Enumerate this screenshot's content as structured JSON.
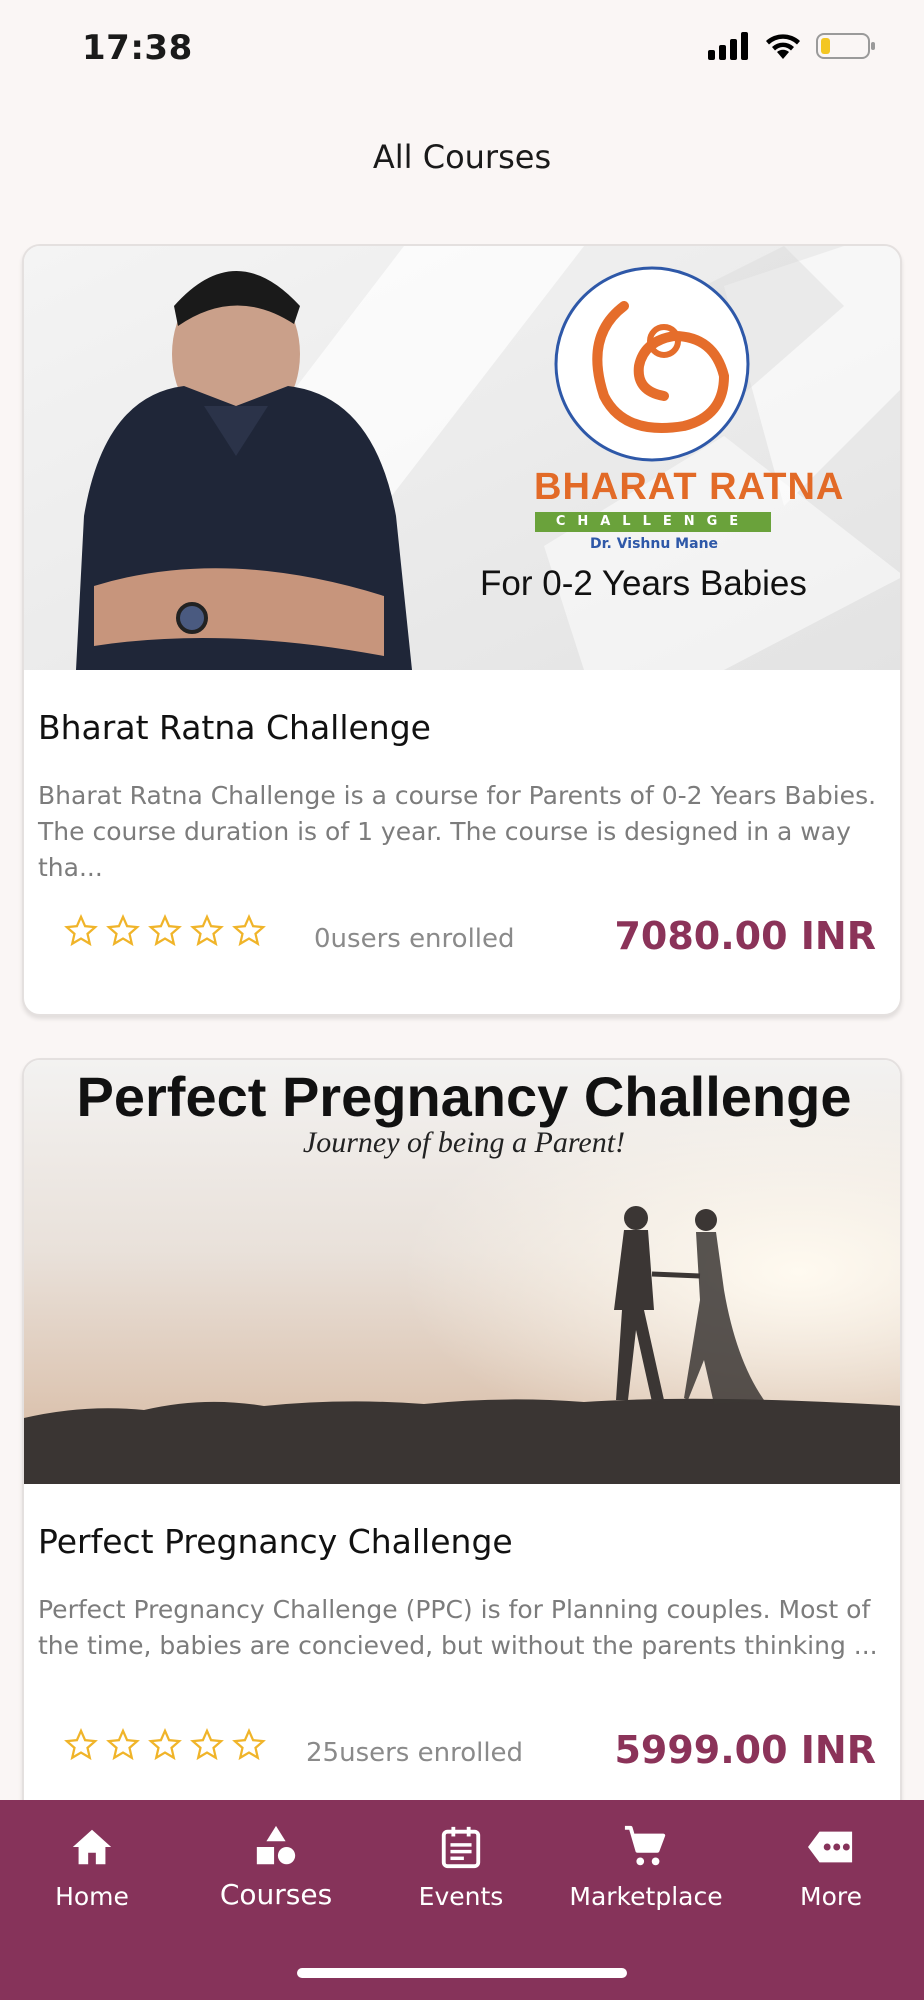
{
  "status": {
    "time": "17:38"
  },
  "header": {
    "title": "All Courses"
  },
  "courses": [
    {
      "banner": {
        "brand_line1": "BHARAT RATNA",
        "brand_line2": "CHALLENGE",
        "brand_line3": "Dr. Vishnu Mane",
        "tagline": "For 0-2 Years Babies"
      },
      "title": "Bharat Ratna Challenge",
      "description": "Bharat Ratna Challenge is a course for Parents of 0-2 Years Babies. The course duration is of 1 year. The course is designed in a way tha...",
      "rating": 0,
      "enrolled": "0users enrolled",
      "price": "7080.00 INR"
    },
    {
      "banner": {
        "headline": "Perfect Pregnancy Challenge",
        "subline": "Journey of being a Parent!"
      },
      "title": "Perfect Pregnancy Challenge",
      "description": "Perfect Pregnancy Challenge (PPC) is for Planning couples. Most of the time, babies are concieved, but without the parents thinking ...",
      "rating": 0,
      "enrolled": "25users enrolled",
      "price": "5999.00 INR"
    }
  ],
  "tabs": [
    {
      "label": "Home",
      "icon": "home-icon"
    },
    {
      "label": "Courses",
      "icon": "shapes-icon",
      "active": true
    },
    {
      "label": "Events",
      "icon": "calendar-icon"
    },
    {
      "label": "Marketplace",
      "icon": "cart-icon"
    },
    {
      "label": "More",
      "icon": "more-icon"
    }
  ],
  "colors": {
    "accent": "#86335a",
    "price": "#8b3359",
    "star": "#f0b429"
  }
}
